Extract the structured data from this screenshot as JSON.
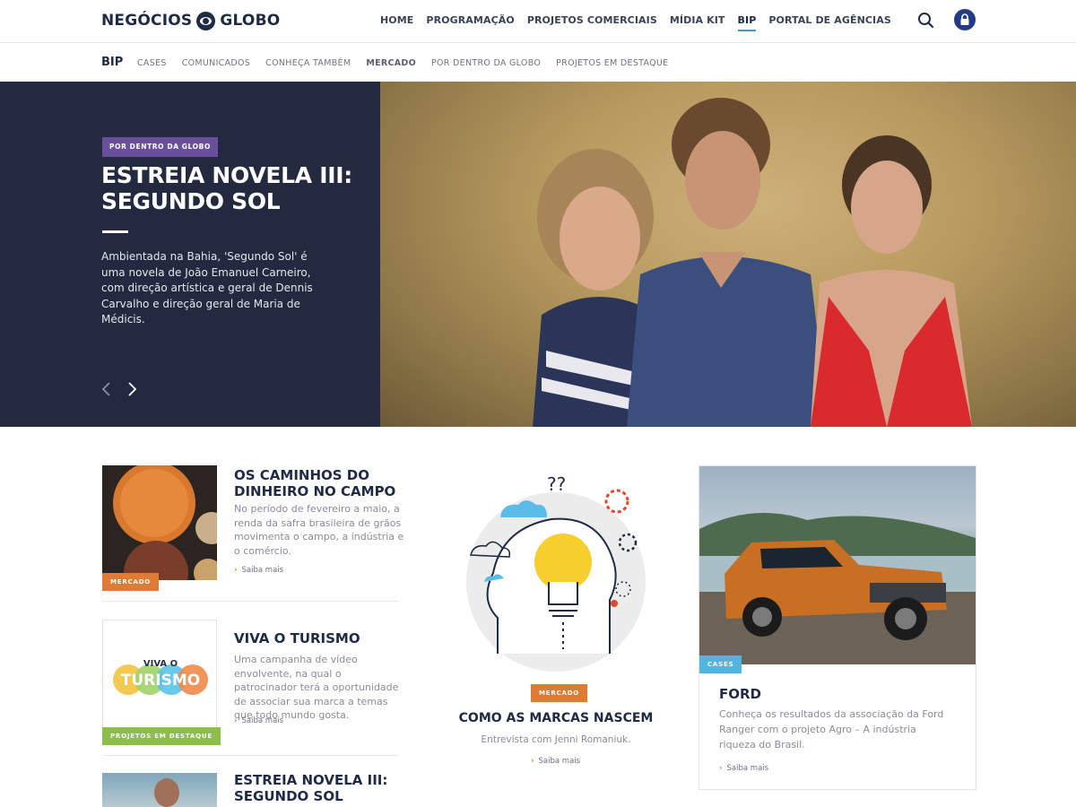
{
  "header": {
    "logo_left": "NEGÓCIOS",
    "logo_right": "GLOBO",
    "nav": [
      "HOME",
      "PROGRAMAÇÃO",
      "PROJETOS COMERCIAIS",
      "MÍDIA KIT",
      "BIP",
      "PORTAL DE AGÊNCIAS"
    ],
    "active_nav": "BIP"
  },
  "subnav": {
    "title": "BIP",
    "links": [
      "CASES",
      "COMUNICADOS",
      "CONHEÇA TAMBÉM",
      "MERCADO",
      "POR DENTRO DA GLOBO",
      "PROJETOS EM DESTAQUE"
    ]
  },
  "hero": {
    "tag": "POR DENTRO DA GLOBO",
    "title": "ESTREIA NOVELA III: SEGUNDO SOL",
    "description": "Ambientada na Bahia, 'Segundo Sol' é uma novela de João Emanuel Carneiro, com direção artística e geral de Dennis Carvalho e direção geral de Maria de Médicis."
  },
  "cards": [
    {
      "badge": "MERCADO",
      "title": "OS CAMINHOS DO DINHEIRO NO CAMPO",
      "text": "No período de fevereiro a maio, a renda da safra brasileira de grãos movimenta o campo, a indústria e o comércio.",
      "more": "Saiba mais"
    },
    {
      "badge": "PROJETOS EM DESTAQUE",
      "title": "VIVA O TURISMO",
      "text": "Uma campanha de vídeo envolvente, na qual o patrocinador terá a oportunidade de associar sua marca a temas que todo mundo gosta.",
      "more": "Saiba mais",
      "logo_top": "VIVA O",
      "logo_main": "TURISMO"
    },
    {
      "title": "ESTREIA NOVELA III: SEGUNDO SOL"
    }
  ],
  "center": {
    "badge": "MERCADO",
    "title": "COMO AS MARCAS NASCEM",
    "subtitle": "Entrevista com Jenni Romaniuk.",
    "more": "Saiba mais",
    "illustration_marks": "??"
  },
  "ford": {
    "badge": "CASES",
    "title": "FORD",
    "text": "Conheça os resultados da associação da Ford Ranger com o projeto Agro – A indústria riqueza do Brasil.",
    "more": "Saiba mais"
  },
  "colors": {
    "navy": "#232a40",
    "purple": "#6a4f9e",
    "orange": "#e07a35",
    "green": "#8dbd4a",
    "blue": "#52b4e0"
  }
}
